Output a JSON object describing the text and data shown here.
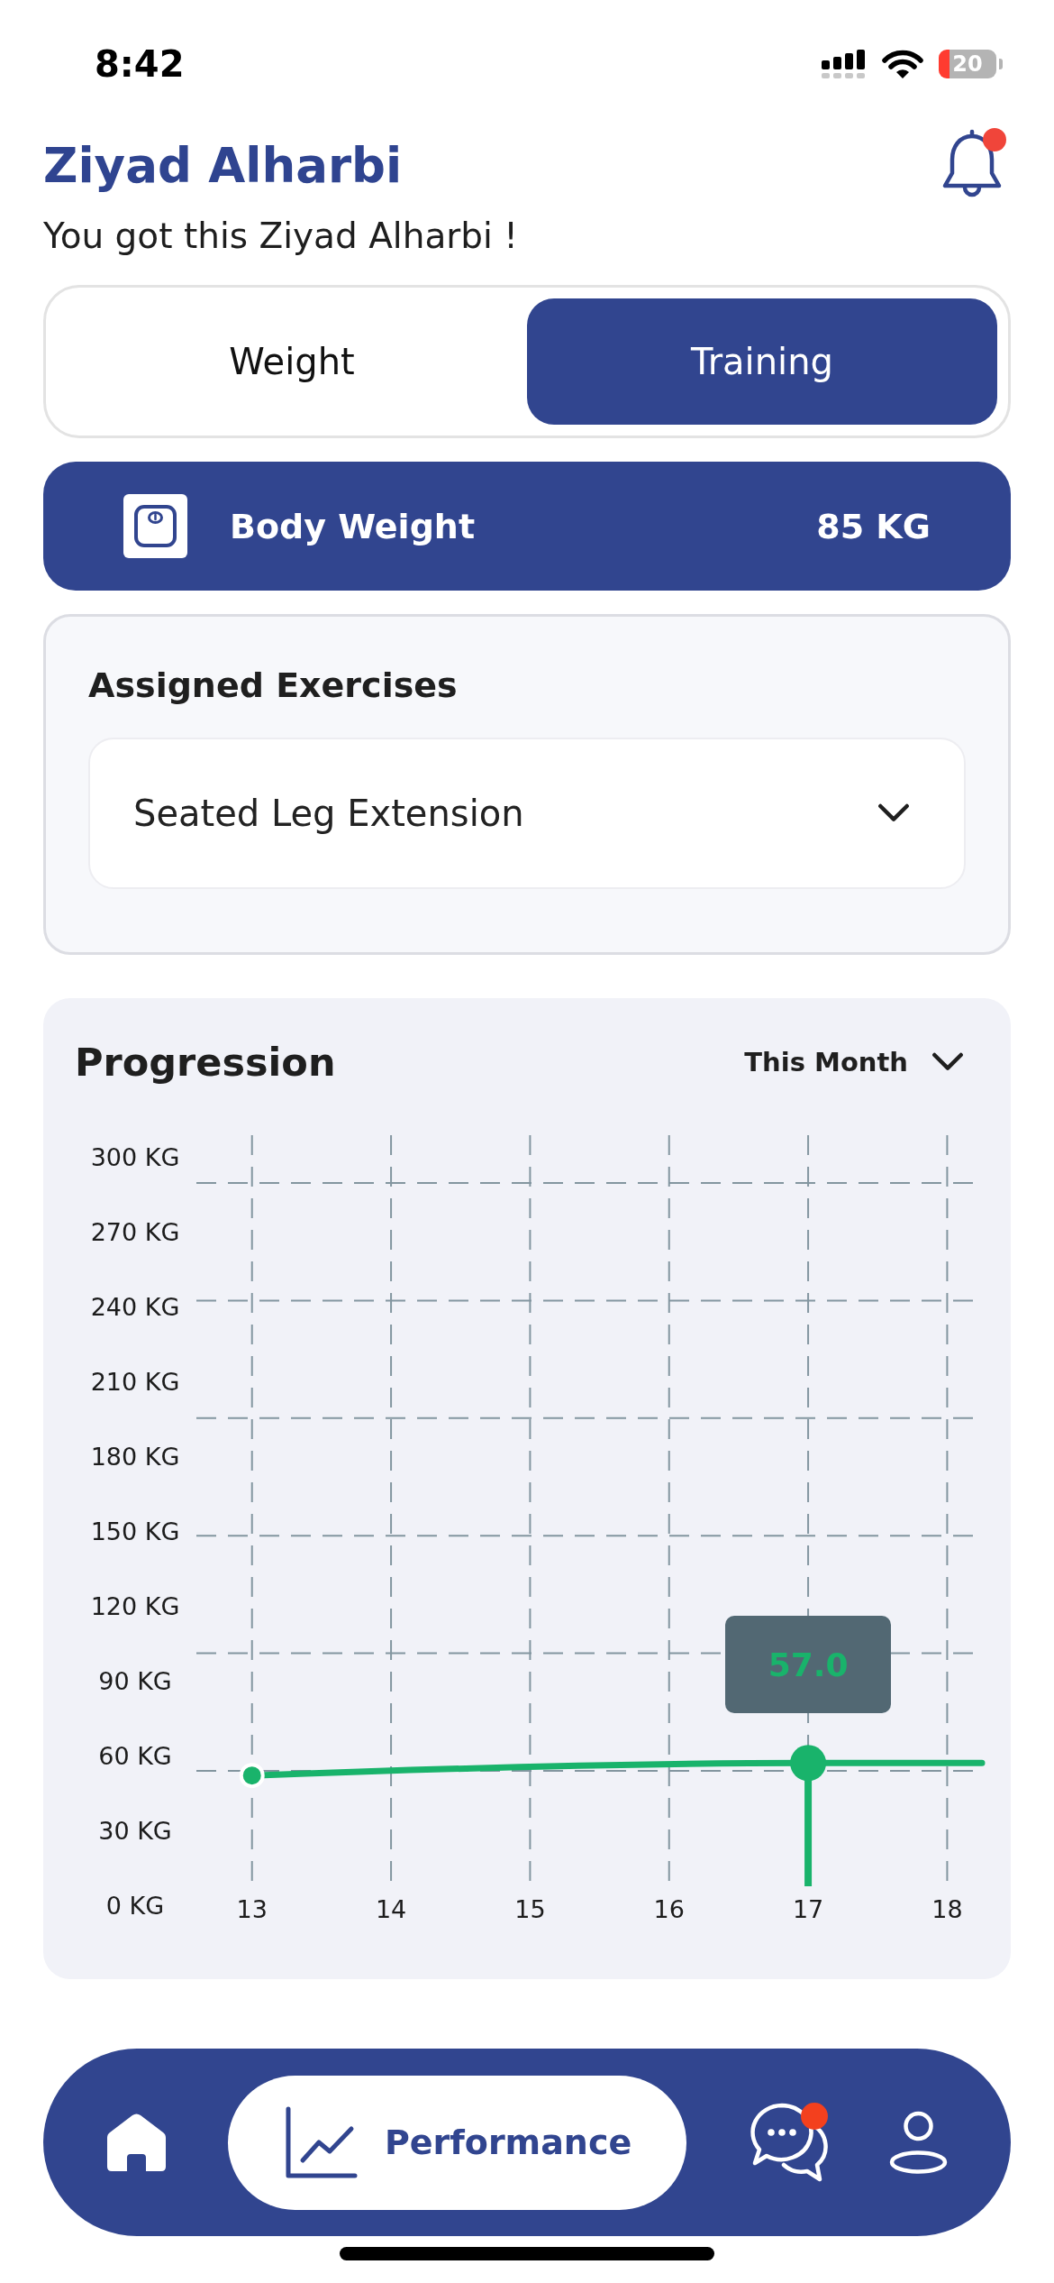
{
  "status_bar": {
    "time": "8:42",
    "battery": "20"
  },
  "header": {
    "title": "Ziyad Alharbi",
    "subtitle": "You got this Ziyad Alharbi !",
    "notification_badge": true
  },
  "tabs": [
    {
      "label": "Weight",
      "selected": false
    },
    {
      "label": "Training",
      "selected": true
    }
  ],
  "body_weight": {
    "label": "Body Weight",
    "value": "85 KG"
  },
  "assigned_exercises": {
    "title": "Assigned Exercises",
    "exercise_select": {
      "value": "Seated Leg Extension"
    }
  },
  "progression": {
    "title": "Progression",
    "period_select": {
      "value": "This Month"
    },
    "chart_data": {
      "type": "line",
      "x": [
        13,
        17,
        18.25
      ],
      "values": [
        52,
        57,
        57
      ],
      "xlim": [
        12.6,
        18.25
      ],
      "xticks": [
        13,
        14,
        15,
        16,
        17,
        18
      ],
      "ylim": [
        0,
        300
      ],
      "yticks": [
        {
          "value": 0,
          "label": "0 KG"
        },
        {
          "value": 30,
          "label": "30 KG"
        },
        {
          "value": 60,
          "label": "60 KG"
        },
        {
          "value": 90,
          "label": "90 KG"
        },
        {
          "value": 120,
          "label": "120 KG"
        },
        {
          "value": 150,
          "label": "150 KG"
        },
        {
          "value": 180,
          "label": "180 KG"
        },
        {
          "value": 210,
          "label": "210 KG"
        },
        {
          "value": 240,
          "label": "240 KG"
        },
        {
          "value": 270,
          "label": "270 KG"
        },
        {
          "value": 300,
          "label": "300 KG"
        }
      ],
      "grid": true,
      "marker": "circle",
      "annotations": [
        {
          "x": 17,
          "y": 57,
          "text": "57.0"
        }
      ]
    }
  },
  "bottom_nav": [
    {
      "kind": "home",
      "selected": false,
      "badge": false
    },
    {
      "kind": "performance",
      "label": "Performance",
      "selected": true,
      "badge": false
    },
    {
      "kind": "chat",
      "selected": false,
      "badge": true
    },
    {
      "kind": "profile",
      "selected": false,
      "badge": false
    }
  ]
}
